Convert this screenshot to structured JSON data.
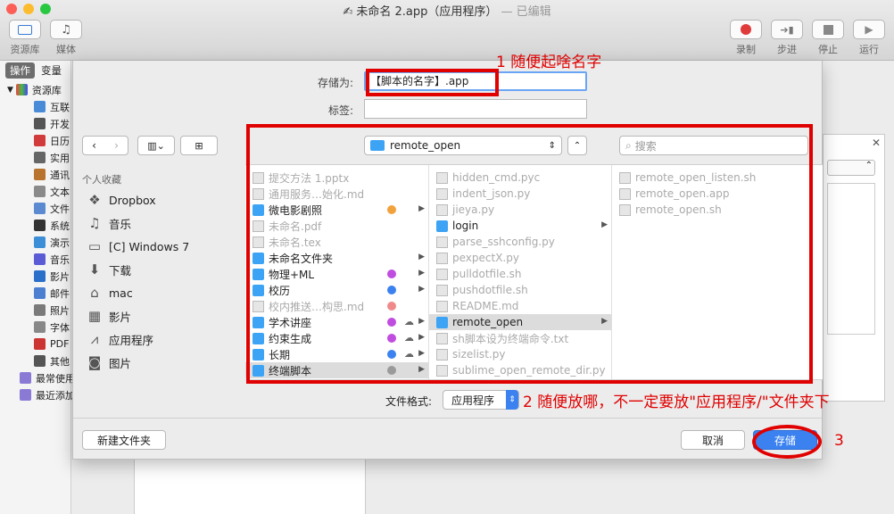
{
  "window": {
    "title": "未命名 2.app（应用程序）",
    "title_suffix": "— 已编辑"
  },
  "toolbar": {
    "library": "资源库",
    "media": "媒体",
    "record": "录制",
    "step": "步进",
    "stop": "停止",
    "run": "运行"
  },
  "left": {
    "tab_actions": "操作",
    "tab_vars": "变量",
    "root": "资源库",
    "items": [
      "互联",
      "开发",
      "日历",
      "实用",
      "通讯",
      "文本",
      "文件",
      "系统",
      "演示",
      "音乐",
      "影片",
      "邮件",
      "照片",
      "字体",
      "PDF",
      "其他"
    ],
    "item_colors": [
      "#4a8bd8",
      "#555555",
      "#d23b3b",
      "#666666",
      "#b8732e",
      "#8a8a8a",
      "#5b8ad0",
      "#333333",
      "#3c8fd6",
      "#5b5bd6",
      "#2a6fc9",
      "#4d7fd0",
      "#7a7a7a",
      "#888888",
      "#cc3333",
      "#555555"
    ],
    "smart1": "最常使用",
    "smart2": "最近添加"
  },
  "save": {
    "save_as_label": "存储为:",
    "save_as_value": "【脚本的名字】.app",
    "tags_label": "标签:",
    "tags_value": "",
    "location": "remote_open",
    "search_placeholder": "搜索",
    "format_label": "文件格式:",
    "format_value": "应用程序",
    "new_folder": "新建文件夹",
    "cancel": "取消",
    "save": "存储"
  },
  "sidebar": {
    "header": "个人收藏",
    "items": [
      {
        "label": "Dropbox",
        "icon": "dropbox-icon",
        "glyph": "❖"
      },
      {
        "label": "音乐",
        "icon": "music-icon",
        "glyph": "♫"
      },
      {
        "label": "[C] Windows 7",
        "icon": "drive-icon",
        "glyph": "▭"
      },
      {
        "label": "下载",
        "icon": "download-icon",
        "glyph": "⬇"
      },
      {
        "label": "mac",
        "icon": "home-icon",
        "glyph": "⌂"
      },
      {
        "label": "影片",
        "icon": "movie-icon",
        "glyph": "▦"
      },
      {
        "label": "应用程序",
        "icon": "apps-icon",
        "glyph": "⩘"
      },
      {
        "label": "图片",
        "icon": "camera-icon",
        "glyph": "◙"
      }
    ]
  },
  "col1": [
    {
      "name": "提交方法 1.pptx",
      "kind": "doc",
      "dim": true
    },
    {
      "name": "通用服务…始化.md",
      "kind": "doc",
      "dim": true
    },
    {
      "name": "微电影剧照",
      "kind": "folder",
      "tags": [
        "#f2a23c"
      ],
      "arrow": true
    },
    {
      "name": "未命名.pdf",
      "kind": "doc",
      "dim": true
    },
    {
      "name": "未命名.tex",
      "kind": "doc",
      "dim": true
    },
    {
      "name": "未命名文件夹",
      "kind": "folder",
      "arrow": true
    },
    {
      "name": "物理+ML",
      "kind": "folder",
      "tags": [
        "#c04ce0"
      ],
      "arrow": true
    },
    {
      "name": "校历",
      "kind": "folder",
      "tags": [
        "#3b82f0"
      ],
      "arrow": true
    },
    {
      "name": "校内推送…构思.md",
      "kind": "doc",
      "dim": true,
      "tags": [
        "#f08a8a"
      ]
    },
    {
      "name": "学术讲座",
      "kind": "folder",
      "tags": [
        "#c04ce0"
      ],
      "cloud": true,
      "arrow": true
    },
    {
      "name": "约束生成",
      "kind": "folder",
      "tags": [
        "#c04ce0"
      ],
      "cloud": true,
      "arrow": true
    },
    {
      "name": "长期",
      "kind": "folder",
      "tags": [
        "#3b82f0"
      ],
      "cloud": true,
      "arrow": true
    },
    {
      "name": "终端脚本",
      "kind": "folder",
      "tags": [
        "#9a9a9a"
      ],
      "arrow": true,
      "selected": true
    }
  ],
  "col2": [
    {
      "name": "hidden_cmd.pyc",
      "kind": "doc",
      "dim": true
    },
    {
      "name": "indent_json.py",
      "kind": "doc",
      "dim": true
    },
    {
      "name": "jieya.py",
      "kind": "doc",
      "dim": true
    },
    {
      "name": "login",
      "kind": "folder",
      "arrow": true
    },
    {
      "name": "parse_sshconfig.py",
      "kind": "doc",
      "dim": true
    },
    {
      "name": "pexpectX.py",
      "kind": "doc",
      "dim": true
    },
    {
      "name": "pulldotfile.sh",
      "kind": "doc",
      "dim": true
    },
    {
      "name": "pushdotfile.sh",
      "kind": "doc",
      "dim": true
    },
    {
      "name": "README.md",
      "kind": "doc",
      "dim": true
    },
    {
      "name": "remote_open",
      "kind": "folder",
      "arrow": true,
      "selected": true
    },
    {
      "name": "sh脚本设为终端命令.txt",
      "kind": "doc",
      "dim": true
    },
    {
      "name": "sizelist.py",
      "kind": "doc",
      "dim": true
    },
    {
      "name": "sublime_open_remote_dir.py",
      "kind": "doc",
      "dim": true
    }
  ],
  "col3": [
    {
      "name": "remote_open_listen.sh",
      "kind": "doc",
      "dim": true
    },
    {
      "name": "remote_open.app",
      "kind": "doc",
      "dim": true
    },
    {
      "name": "remote_open.sh",
      "kind": "doc",
      "dim": true
    }
  ],
  "annotations": {
    "a1": "1 随便起啥名字",
    "a2": "2 随便放哪，不一定要放\"应用程序/\"文件夹下",
    "a3": "3"
  }
}
